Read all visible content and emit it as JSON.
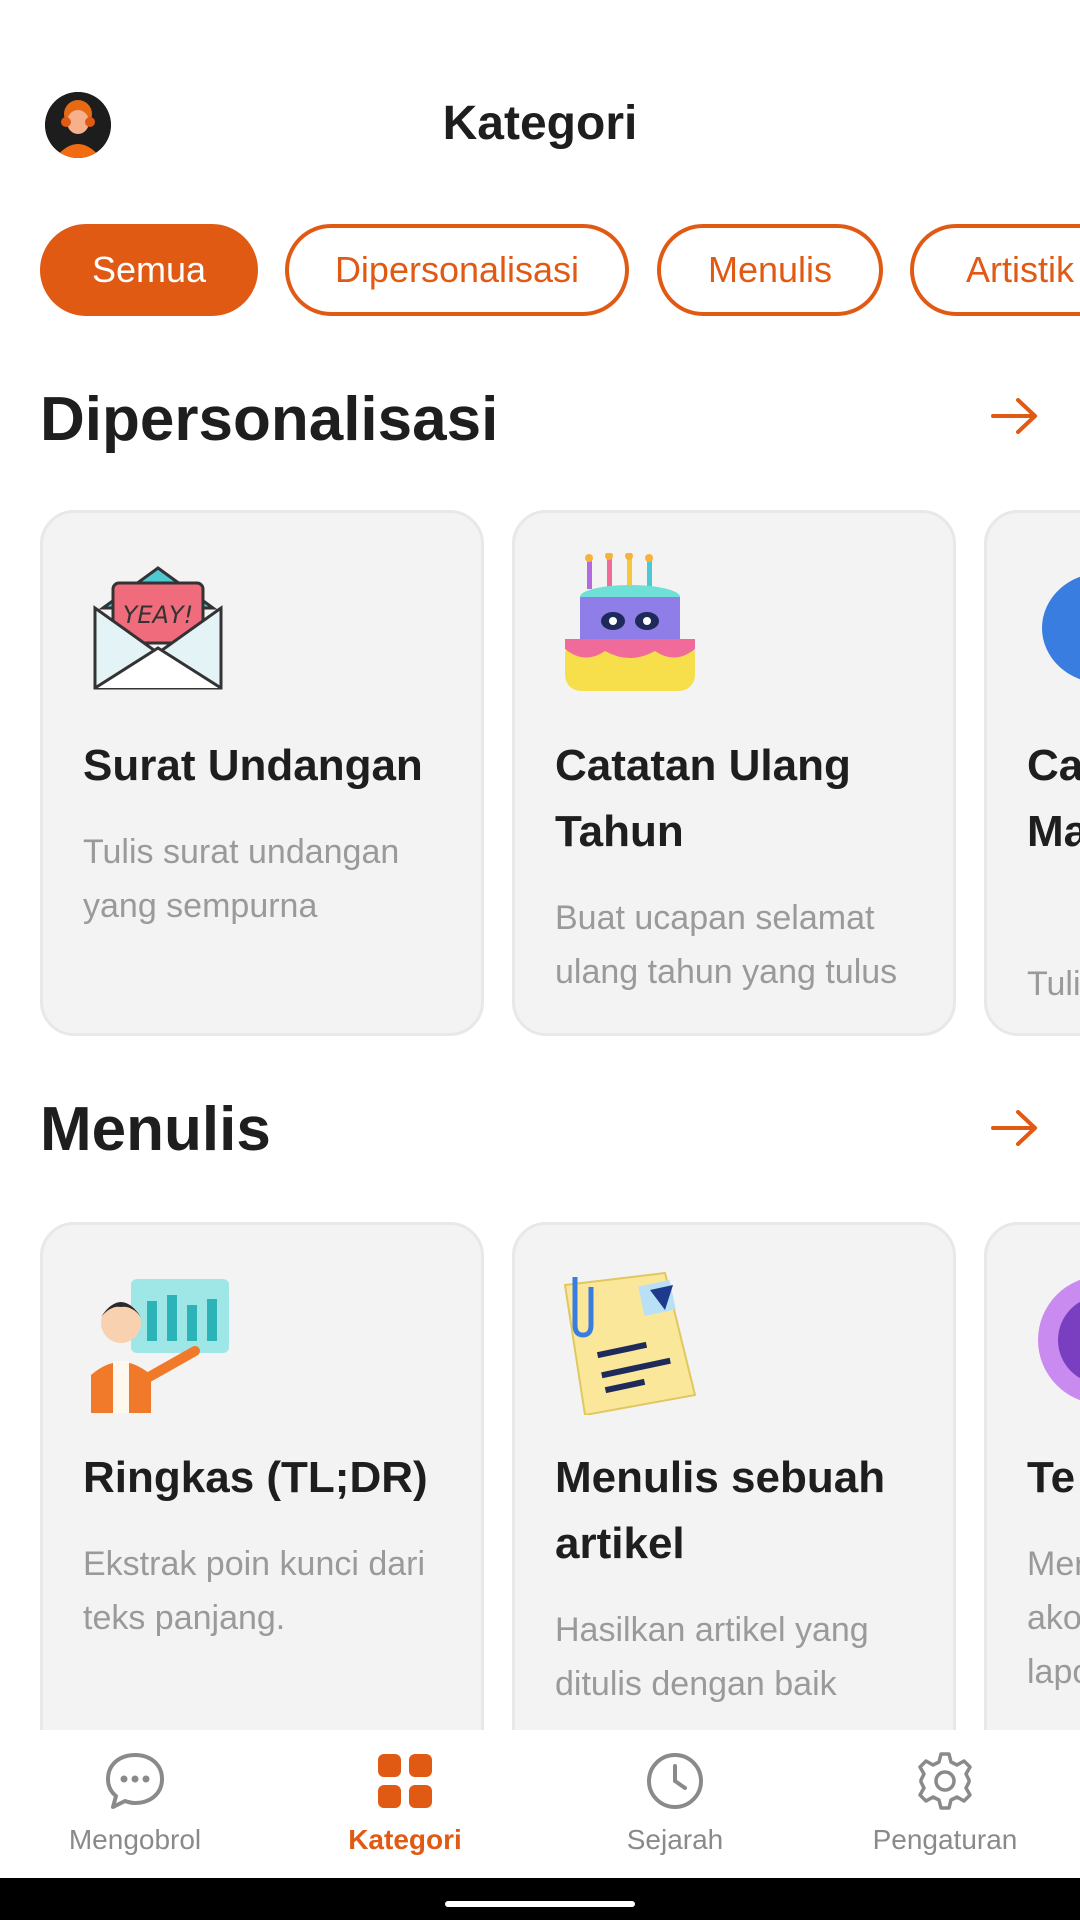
{
  "header": {
    "title": "Kategori"
  },
  "tabs": [
    {
      "label": "Semua",
      "active": true
    },
    {
      "label": "Dipersonalisasi",
      "active": false
    },
    {
      "label": "Menulis",
      "active": false
    },
    {
      "label": "Artistik",
      "active": false
    }
  ],
  "sections": [
    {
      "title": "Dipersonalisasi",
      "cards": [
        {
          "title": "Surat Undangan",
          "desc": "Tulis surat undangan yang sempurna",
          "icon": "invitation-envelope-icon"
        },
        {
          "title": "Catatan Ulang Tahun",
          "desc": "Buat ucapan selamat ulang tahun yang tulus",
          "icon": "birthday-cake-icon"
        },
        {
          "title": "Ca Per Ma",
          "desc": "Tuli",
          "icon": "partial-card-icon"
        }
      ]
    },
    {
      "title": "Menulis",
      "cards": [
        {
          "title": "Ringkas (TL;DR)",
          "desc": "Ekstrak poin kunci dari teks panjang.",
          "icon": "presenter-chart-icon"
        },
        {
          "title": "Menulis sebuah artikel",
          "desc": "Hasilkan artikel yang ditulis dengan baik",
          "icon": "note-paper-icon"
        },
        {
          "title": "Te",
          "desc": "Mer ako lapo",
          "icon": "partial-card-icon"
        }
      ]
    }
  ],
  "nav": [
    {
      "label": "Mengobrol",
      "icon": "chat-icon",
      "active": false
    },
    {
      "label": "Kategori",
      "icon": "grid-icon",
      "active": true
    },
    {
      "label": "Sejarah",
      "icon": "clock-icon",
      "active": false
    },
    {
      "label": "Pengaturan",
      "icon": "gear-icon",
      "active": false
    }
  ],
  "colors": {
    "accent": "#e15a14",
    "card_bg": "#f3f3f3",
    "text_muted": "#9a9a9a"
  }
}
